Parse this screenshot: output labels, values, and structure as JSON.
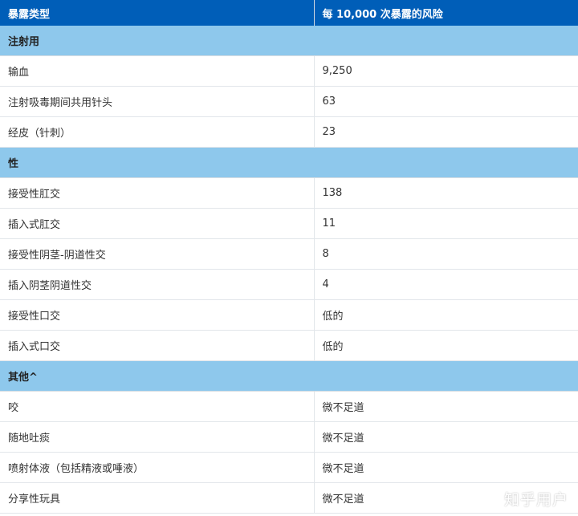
{
  "table": {
    "headers": [
      "暴露类型",
      "每 10,000 次暴露的风险"
    ],
    "sections": [
      {
        "title": "注射用",
        "rows": [
          [
            "输血",
            "9,250"
          ],
          [
            "注射吸毒期间共用针头",
            "63"
          ],
          [
            "经皮（针刺）",
            "23"
          ]
        ]
      },
      {
        "title": "性",
        "rows": [
          [
            "接受性肛交",
            "138"
          ],
          [
            "插入式肛交",
            "11"
          ],
          [
            "接受性阴茎-阴道性交",
            "8"
          ],
          [
            "插入阴茎阴道性交",
            "4"
          ],
          [
            "接受性口交",
            "低的"
          ],
          [
            "插入式口交",
            "低的"
          ]
        ]
      },
      {
        "title": "其他^",
        "rows": [
          [
            "咬",
            "微不足道"
          ],
          [
            "随地吐痰",
            "微不足道"
          ],
          [
            "喷射体液（包括精液或唾液）",
            "微不足道"
          ],
          [
            "分享性玩具",
            "微不足道"
          ]
        ]
      }
    ]
  },
  "watermark": "知乎用户",
  "colors": {
    "header_bg": "#005eb8",
    "section_bg": "#8ec8ec"
  }
}
